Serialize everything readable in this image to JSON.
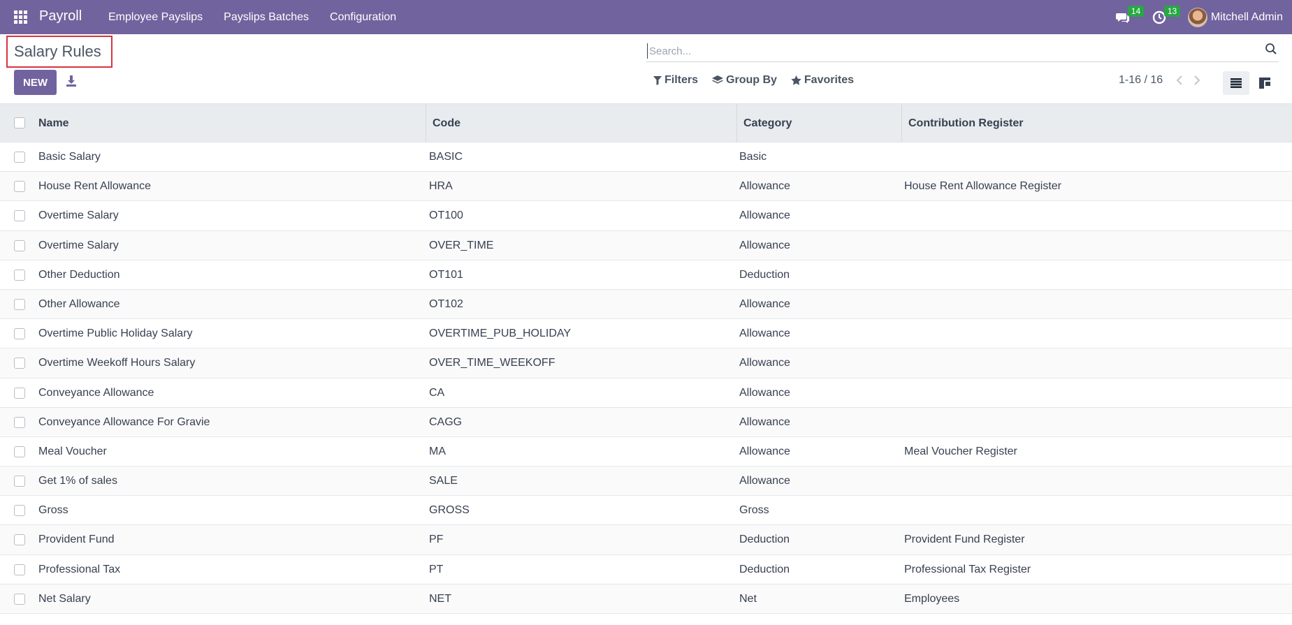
{
  "navbar": {
    "app_name": "Payroll",
    "menu": [
      "Employee Payslips",
      "Payslips Batches",
      "Configuration"
    ],
    "messages_count": "14",
    "activities_count": "13",
    "user_name": "Mitchell Admin"
  },
  "control_panel": {
    "title": "Salary Rules",
    "new_label": "NEW",
    "search_placeholder": "Search...",
    "filters_label": "Filters",
    "group_by_label": "Group By",
    "favorites_label": "Favorites",
    "pager": "1-16 / 16"
  },
  "table": {
    "columns": [
      "Name",
      "Code",
      "Category",
      "Contribution Register"
    ],
    "rows": [
      {
        "name": "Basic Salary",
        "code": "BASIC",
        "category": "Basic",
        "register": ""
      },
      {
        "name": "House Rent Allowance",
        "code": "HRA",
        "category": "Allowance",
        "register": "House Rent Allowance Register"
      },
      {
        "name": "Overtime Salary",
        "code": "OT100",
        "category": "Allowance",
        "register": ""
      },
      {
        "name": "Overtime Salary",
        "code": "OVER_TIME",
        "category": "Allowance",
        "register": ""
      },
      {
        "name": "Other Deduction",
        "code": "OT101",
        "category": "Deduction",
        "register": ""
      },
      {
        "name": "Other Allowance",
        "code": "OT102",
        "category": "Allowance",
        "register": ""
      },
      {
        "name": "Overtime Public Holiday Salary",
        "code": "OVERTIME_PUB_HOLIDAY",
        "category": "Allowance",
        "register": ""
      },
      {
        "name": "Overtime Weekoff Hours Salary",
        "code": "OVER_TIME_WEEKOFF",
        "category": "Allowance",
        "register": ""
      },
      {
        "name": "Conveyance Allowance",
        "code": "CA",
        "category": "Allowance",
        "register": ""
      },
      {
        "name": "Conveyance Allowance For Gravie",
        "code": "CAGG",
        "category": "Allowance",
        "register": ""
      },
      {
        "name": "Meal Voucher",
        "code": "MA",
        "category": "Allowance",
        "register": "Meal Voucher Register"
      },
      {
        "name": "Get 1% of sales",
        "code": "SALE",
        "category": "Allowance",
        "register": ""
      },
      {
        "name": "Gross",
        "code": "GROSS",
        "category": "Gross",
        "register": ""
      },
      {
        "name": "Provident Fund",
        "code": "PF",
        "category": "Deduction",
        "register": "Provident Fund Register"
      },
      {
        "name": "Professional Tax",
        "code": "PT",
        "category": "Deduction",
        "register": "Professional Tax Register"
      },
      {
        "name": "Net Salary",
        "code": "NET",
        "category": "Net",
        "register": "Employees"
      }
    ]
  },
  "colors": {
    "brand": "#71639e",
    "highlight_border": "#d9343f",
    "badge": "#28a745"
  }
}
